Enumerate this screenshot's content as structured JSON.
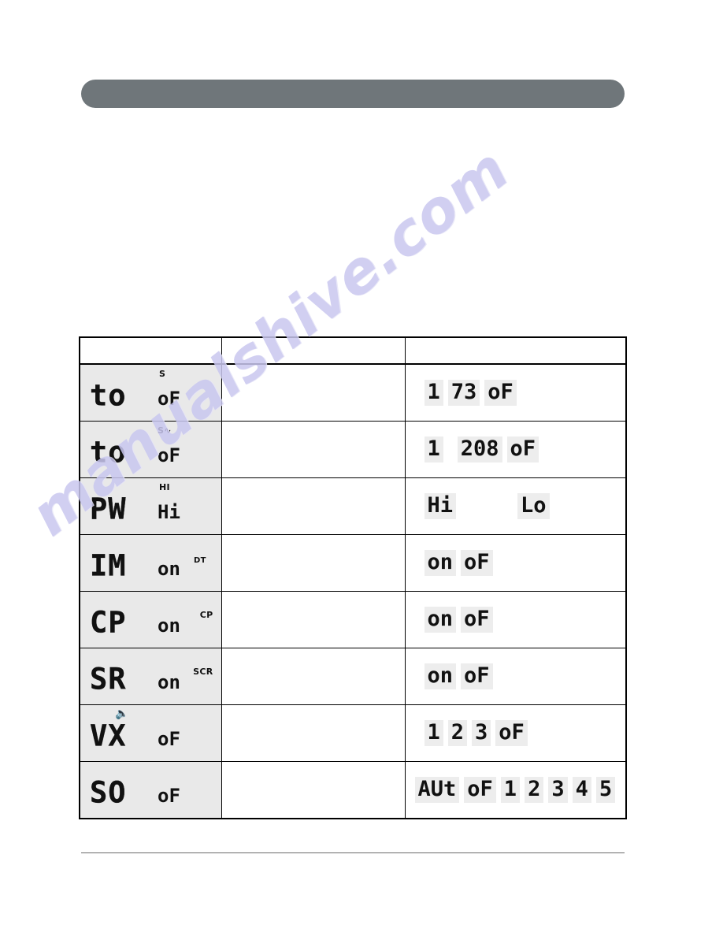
{
  "page": {
    "header_bar": {
      "label": "",
      "color": "#6f767a"
    },
    "watermark": {
      "text": "manualshive.com",
      "color": "#c9c7ef"
    },
    "footer_rule": {
      "color": "#6a6a6a"
    }
  },
  "table": {
    "columns": [
      {
        "header": ""
      },
      {
        "header": ""
      },
      {
        "header": ""
      }
    ],
    "rows": [
      {
        "display": {
          "main": "to",
          "sub": "oF",
          "flag_top": "S",
          "flag_right": "",
          "flag_sup": "",
          "icon": ""
        },
        "description": "",
        "options": [
          "1",
          "73",
          "oF"
        ]
      },
      {
        "display": {
          "main": "to",
          "sub": "oF",
          "flag_top": "S∿",
          "flag_right": "",
          "flag_sup": "",
          "icon": ""
        },
        "description": "",
        "options": [
          "1",
          "208",
          "oF"
        ]
      },
      {
        "display": {
          "main": "PW",
          "sub": "Hi",
          "flag_top": "HI",
          "flag_right": "",
          "flag_sup": "",
          "icon": ""
        },
        "description": "",
        "options": [
          "Hi",
          "Lo"
        ]
      },
      {
        "display": {
          "main": "IM",
          "sub": "on",
          "flag_top": "",
          "flag_right": "",
          "flag_sup": "DT",
          "icon": ""
        },
        "description": "",
        "options": [
          "on",
          "oF"
        ]
      },
      {
        "display": {
          "main": "CP",
          "sub": "on",
          "flag_top": "",
          "flag_right": "CP",
          "flag_sup": "",
          "icon": ""
        },
        "description": "",
        "options": [
          "on",
          "oF"
        ]
      },
      {
        "display": {
          "main": "SR",
          "sub": "on",
          "flag_top": "",
          "flag_right": "SCR",
          "flag_sup": "",
          "icon": ""
        },
        "description": "",
        "options": [
          "on",
          "oF"
        ]
      },
      {
        "display": {
          "main": "VX",
          "sub": "oF",
          "flag_top": "",
          "flag_right": "",
          "flag_sup": "",
          "icon": "speaker-icon"
        },
        "description": "",
        "options": [
          "1",
          "2",
          "3",
          "oF"
        ]
      },
      {
        "display": {
          "main": "SO",
          "sub": "oF",
          "flag_top": "",
          "flag_right": "",
          "flag_sup": "",
          "icon": ""
        },
        "description": "",
        "options": [
          "AUt",
          "oF",
          "1",
          "2",
          "3",
          "4",
          "5"
        ]
      }
    ]
  }
}
